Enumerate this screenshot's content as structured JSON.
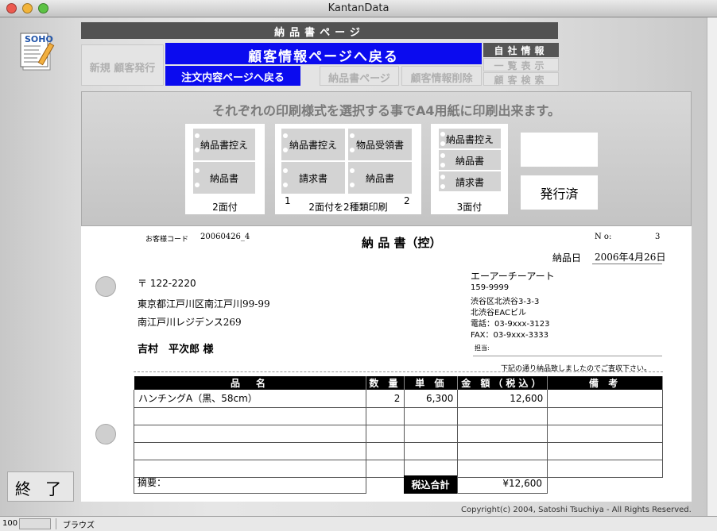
{
  "window": {
    "title": "KantanData"
  },
  "logo": {
    "text": "SOHO"
  },
  "header": {
    "title": "納品書ページ"
  },
  "nav": {
    "new_customer": "新規 顧客発行",
    "back_customer": "顧客情報ページへ戻る",
    "back_order": "注文内容ページへ戻る",
    "delivery_page": "納品書ページ",
    "delete_customer": "顧客情報削除",
    "company_info": "自社情報",
    "list_view": "一覧表示",
    "customer_search": "顧客検索"
  },
  "print_panel": {
    "message": "それぞれの印刷様式を選択する事でA4用紙に印刷出来ます。",
    "opt1": {
      "top": "納品書控え",
      "bottom": "納品書",
      "caption": "2面付"
    },
    "opt2": {
      "top_left": "納品書控え",
      "top_right": "物品受領書",
      "bottom_left": "請求書",
      "bottom_right": "納品書",
      "caption": "2面付を2種類印刷",
      "num_left": "1",
      "num_right": "2"
    },
    "opt3": {
      "row1": "納品書控え",
      "row2": "納品書",
      "row3": "請求書",
      "caption": "3面付"
    },
    "issued_label": "発行済"
  },
  "document": {
    "customer_code_label": "お客様コード",
    "customer_code": "20060426_4",
    "doc_title": "納 品 書（控）",
    "no_label": "N o:",
    "no_value": "3",
    "date_label": "納品日",
    "date_value": "2006年4月26日",
    "postal": "〒 122-2220",
    "addr1": "東京都江戸川区南江戸川99-99",
    "addr2": "南江戸川レジデンス269",
    "customer_name": "吉村　平次郎 様",
    "company": {
      "name": "エーアーチーアート",
      "postal": "159-9999",
      "addr1": "渋谷区北渋谷3-3-3",
      "addr2": "北渋谷EACビル",
      "tel": "電話：03-9xxx-3123",
      "fax": "FAX：03-9xxx-3333",
      "person_label": "担当:"
    },
    "note": "下記の通り納品致しましたのでご査収下さい。",
    "table": {
      "headers": [
        "品　名",
        "数 量",
        "単 価",
        "金 額（税込）",
        "備 考"
      ],
      "rows": [
        [
          "ハンチングA（黒、58cm）",
          "2",
          "6,300",
          "12,600",
          ""
        ]
      ]
    },
    "memo_label": "摘要：",
    "total_label": "税込合計",
    "total_value": "¥12,600"
  },
  "footer": {
    "copyright": "Copyright(c) 2004, Satoshi Tsuchiya - All Rights Reserved."
  },
  "end_button": "終 了",
  "status": {
    "zoom": "100",
    "mode": "ブラウズ"
  }
}
